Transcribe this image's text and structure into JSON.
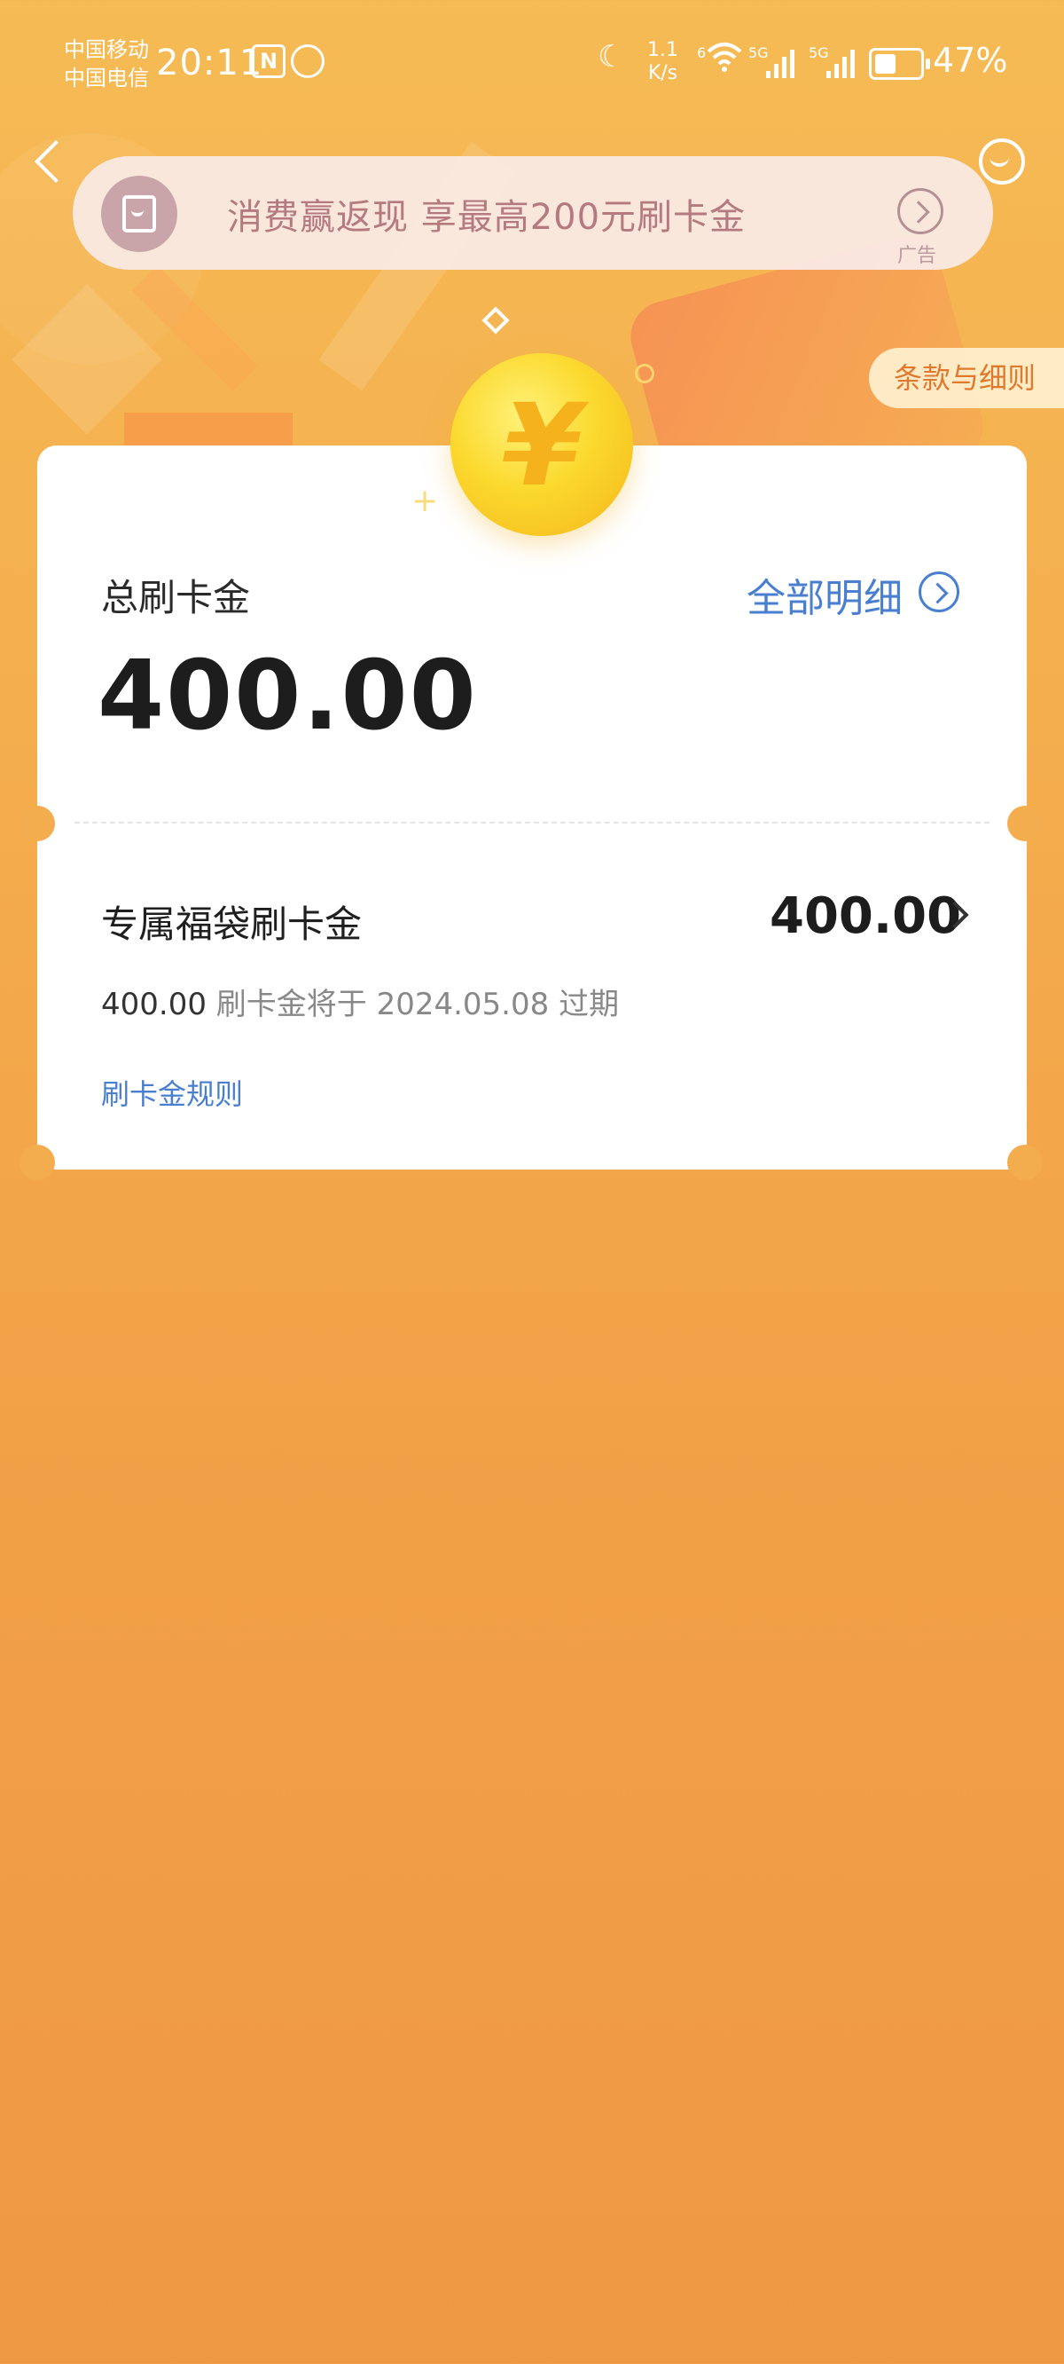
{
  "status_bar": {
    "carrier_1": "中国移动",
    "carrier_2": "中国电信",
    "time": "20:11",
    "net_speed_value": "1.1",
    "net_speed_unit": "K/s",
    "wifi_label": "6",
    "sig1_label": "5G",
    "sig2_label": "5G",
    "battery_percent": 47,
    "battery_text": "47%",
    "icons": [
      "nfc-icon",
      "alarm-icon",
      "moon-icon",
      "wifi-icon",
      "signal-icon",
      "battery-icon"
    ]
  },
  "nav": {
    "back_icon": "chevron-left-icon",
    "service_icon": "customer-service-icon"
  },
  "ad_banner": {
    "text": "消费赢返现  享最高200元刷卡金",
    "tag": "广告",
    "icon": "red-envelope-icon"
  },
  "terms_label": "条款与细则",
  "summary": {
    "total_label": "总刷卡金",
    "detail_link": "全部明细",
    "total_amount": "400.00"
  },
  "item": {
    "title": "专属福袋刷卡金",
    "amount": "400.00",
    "expire_amount": "400.00",
    "expire_text": "刷卡金将于 2024.05.08 过期",
    "rules_link": "刷卡金规则"
  },
  "colors": {
    "accent_blue": "#4a7fd0",
    "background_orange": "#f2a147",
    "terms_orange": "#e0782e"
  }
}
